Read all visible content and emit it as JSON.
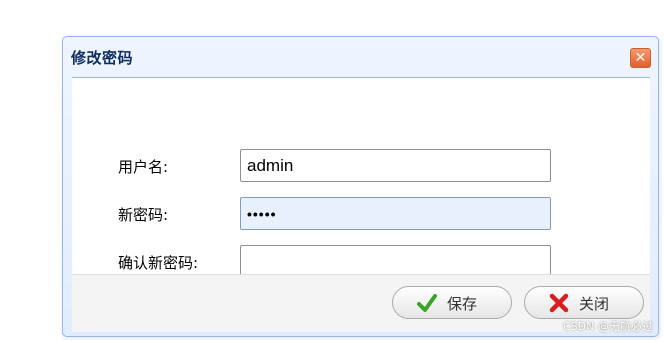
{
  "dialog": {
    "title": "修改密码",
    "close_icon": "close-x-icon"
  },
  "form": {
    "username": {
      "label": "用户名:",
      "value": "admin"
    },
    "new_password": {
      "label": "新密码:",
      "value": "•••••"
    },
    "confirm_password": {
      "label": "确认新密码:",
      "value": ""
    }
  },
  "buttons": {
    "save": {
      "label": "保存",
      "icon": "check-icon"
    },
    "close": {
      "label": "关闭",
      "icon": "red-x-icon"
    }
  },
  "watermark": "CSDN @无航必过",
  "colors": {
    "border": "#95b8e7",
    "title_text": "#0e2d5f",
    "close_button": "#e8703f",
    "focused_field": "#e8f0fe",
    "check_green": "#3aa42a",
    "x_red": "#d62020"
  }
}
